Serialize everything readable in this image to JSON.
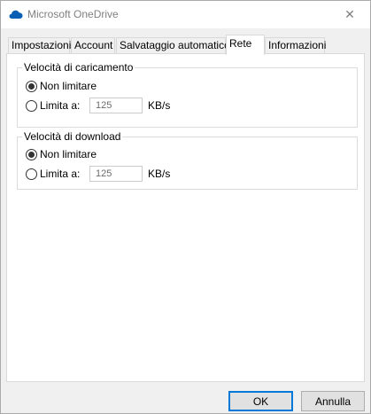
{
  "window": {
    "title": "Microsoft OneDrive",
    "close_glyph": "✕",
    "accent_color": "#0078d7",
    "icon": "onedrive-cloud-icon"
  },
  "tabs": [
    {
      "label": "Impostazioni",
      "active": false
    },
    {
      "label": "Account",
      "active": false
    },
    {
      "label": "Salvataggio automatico",
      "active": false
    },
    {
      "label": "Rete",
      "active": true
    },
    {
      "label": "Informazioni",
      "active": false
    }
  ],
  "upload": {
    "legend": "Velocità di caricamento",
    "option_unlimited": "Non limitare",
    "option_limit": "Limita a:",
    "selected": "Non limitare",
    "rate_value": "125",
    "unit": "KB/s"
  },
  "download": {
    "legend": "Velocità di download",
    "option_unlimited": "Non limitare",
    "option_limit": "Limita a:",
    "selected": "Non limitare",
    "rate_value": "125",
    "unit": "KB/s"
  },
  "buttons": {
    "ok_label": "OK",
    "cancel_label": "Annulla"
  }
}
